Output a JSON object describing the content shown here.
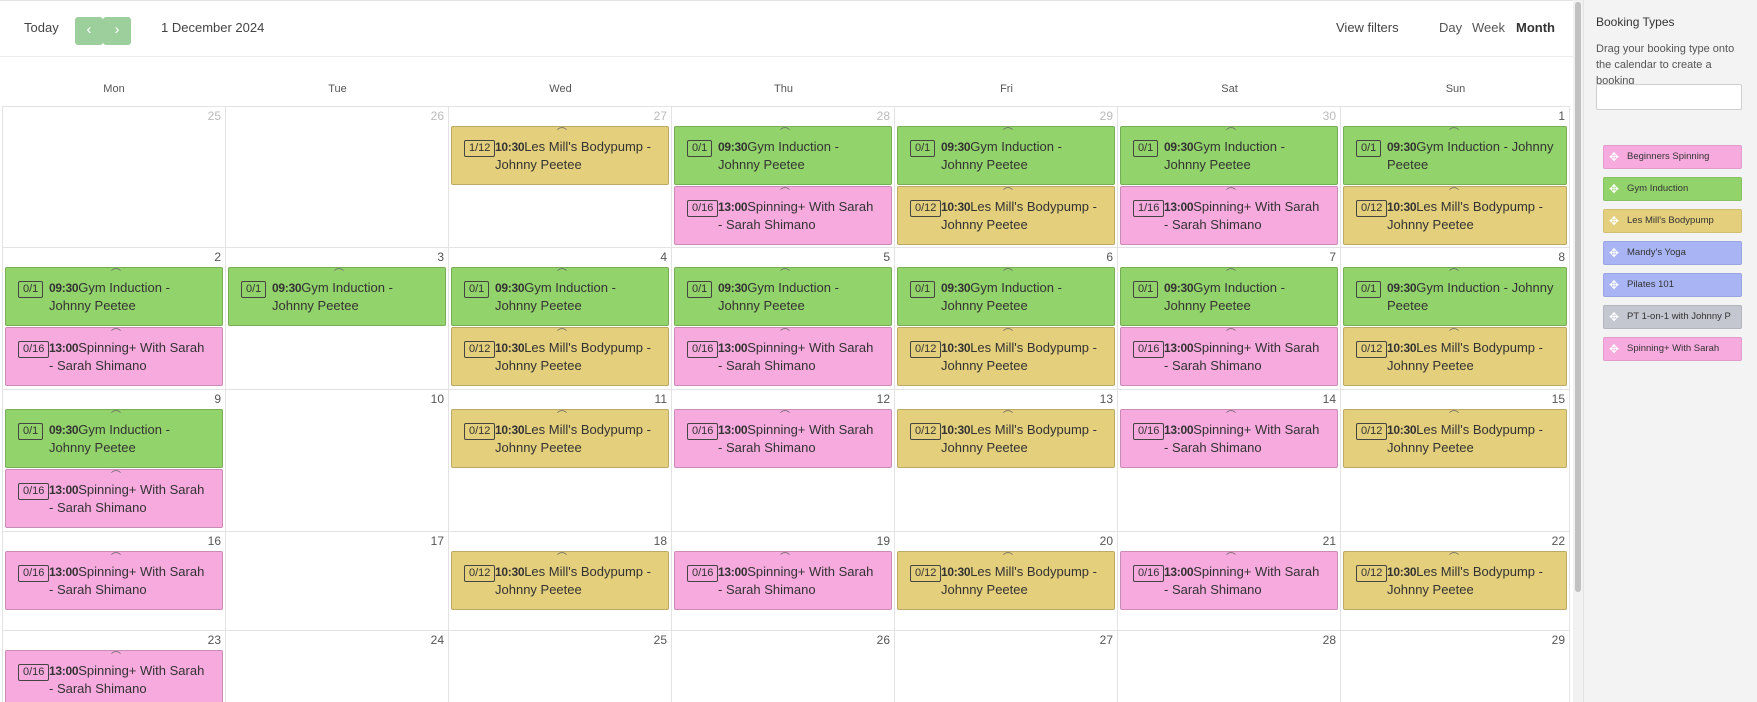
{
  "colors": {
    "green": "#93d36b",
    "pink": "#f7aade",
    "yellow": "#e4cf7c",
    "blue": "#a9b4f5",
    "grey": "#c4c6d0",
    "nav_button": "#9ccf9c"
  },
  "toolbar": {
    "today_label": "Today",
    "prev_icon": "chevron-left-icon",
    "prev_glyph": "‹",
    "next_icon": "chevron-right-icon",
    "next_glyph": "›",
    "current_date": "1 December 2024",
    "view_filters_label": "View filters",
    "views": [
      "Day",
      "Week",
      "Month"
    ],
    "active_view": "Month"
  },
  "calendar": {
    "weekdays": [
      "Mon",
      "Tue",
      "Wed",
      "Thu",
      "Fri",
      "Sat",
      "Sun"
    ],
    "weeks": [
      [
        {
          "day": "25",
          "muted": true,
          "events": []
        },
        {
          "day": "26",
          "muted": true,
          "events": []
        },
        {
          "day": "27",
          "muted": true,
          "events": [
            {
              "type": "bodypump",
              "capacity": "1/12",
              "time": "10:30",
              "title": "Les Mill's Bodypump - Johnny Peetee"
            }
          ]
        },
        {
          "day": "28",
          "muted": true,
          "events": [
            {
              "type": "induction",
              "capacity": "0/1",
              "time": "09:30",
              "title": "Gym Induction - Johnny Peetee"
            },
            {
              "type": "spinning",
              "capacity": "0/16",
              "time": "13:00",
              "title": "Spinning+ With Sarah - Sarah Shimano"
            }
          ]
        },
        {
          "day": "29",
          "muted": true,
          "events": [
            {
              "type": "induction",
              "capacity": "0/1",
              "time": "09:30",
              "title": "Gym Induction - Johnny Peetee"
            },
            {
              "type": "bodypump",
              "capacity": "0/12",
              "time": "10:30",
              "title": "Les Mill's Bodypump - Johnny Peetee"
            }
          ]
        },
        {
          "day": "30",
          "muted": true,
          "events": [
            {
              "type": "induction",
              "capacity": "0/1",
              "time": "09:30",
              "title": "Gym Induction - Johnny Peetee"
            },
            {
              "type": "spinning",
              "capacity": "1/16",
              "time": "13:00",
              "title": "Spinning+ With Sarah - Sarah Shimano"
            }
          ]
        },
        {
          "day": "1",
          "muted": false,
          "events": [
            {
              "type": "induction",
              "capacity": "0/1",
              "time": "09:30",
              "title": "Gym Induction - Johnny Peetee"
            },
            {
              "type": "bodypump",
              "capacity": "0/12",
              "time": "10:30",
              "title": "Les Mill's Bodypump - Johnny Peetee"
            }
          ]
        }
      ],
      [
        {
          "day": "2",
          "muted": false,
          "events": [
            {
              "type": "induction",
              "capacity": "0/1",
              "time": "09:30",
              "title": "Gym Induction - Johnny Peetee"
            },
            {
              "type": "spinning",
              "capacity": "0/16",
              "time": "13:00",
              "title": "Spinning+ With Sarah - Sarah Shimano"
            }
          ]
        },
        {
          "day": "3",
          "muted": false,
          "events": [
            {
              "type": "induction",
              "capacity": "0/1",
              "time": "09:30",
              "title": "Gym Induction - Johnny Peetee"
            }
          ]
        },
        {
          "day": "4",
          "muted": false,
          "events": [
            {
              "type": "induction",
              "capacity": "0/1",
              "time": "09:30",
              "title": "Gym Induction - Johnny Peetee"
            },
            {
              "type": "bodypump",
              "capacity": "0/12",
              "time": "10:30",
              "title": "Les Mill's Bodypump - Johnny Peetee"
            }
          ]
        },
        {
          "day": "5",
          "muted": false,
          "events": [
            {
              "type": "induction",
              "capacity": "0/1",
              "time": "09:30",
              "title": "Gym Induction - Johnny Peetee"
            },
            {
              "type": "spinning",
              "capacity": "0/16",
              "time": "13:00",
              "title": "Spinning+ With Sarah - Sarah Shimano"
            }
          ]
        },
        {
          "day": "6",
          "muted": false,
          "events": [
            {
              "type": "induction",
              "capacity": "0/1",
              "time": "09:30",
              "title": "Gym Induction - Johnny Peetee"
            },
            {
              "type": "bodypump",
              "capacity": "0/12",
              "time": "10:30",
              "title": "Les Mill's Bodypump - Johnny Peetee"
            }
          ]
        },
        {
          "day": "7",
          "muted": false,
          "events": [
            {
              "type": "induction",
              "capacity": "0/1",
              "time": "09:30",
              "title": "Gym Induction - Johnny Peetee"
            },
            {
              "type": "spinning",
              "capacity": "0/16",
              "time": "13:00",
              "title": "Spinning+ With Sarah - Sarah Shimano"
            }
          ]
        },
        {
          "day": "8",
          "muted": false,
          "events": [
            {
              "type": "induction",
              "capacity": "0/1",
              "time": "09:30",
              "title": "Gym Induction - Johnny Peetee"
            },
            {
              "type": "bodypump",
              "capacity": "0/12",
              "time": "10:30",
              "title": "Les Mill's Bodypump - Johnny Peetee"
            }
          ]
        }
      ],
      [
        {
          "day": "9",
          "muted": false,
          "events": [
            {
              "type": "induction",
              "capacity": "0/1",
              "time": "09:30",
              "title": "Gym Induction - Johnny Peetee"
            },
            {
              "type": "spinning",
              "capacity": "0/16",
              "time": "13:00",
              "title": "Spinning+ With Sarah - Sarah Shimano"
            }
          ]
        },
        {
          "day": "10",
          "muted": false,
          "events": []
        },
        {
          "day": "11",
          "muted": false,
          "events": [
            {
              "type": "bodypump",
              "capacity": "0/12",
              "time": "10:30",
              "title": "Les Mill's Bodypump - Johnny Peetee"
            }
          ]
        },
        {
          "day": "12",
          "muted": false,
          "events": [
            {
              "type": "spinning",
              "capacity": "0/16",
              "time": "13:00",
              "title": "Spinning+ With Sarah - Sarah Shimano"
            }
          ]
        },
        {
          "day": "13",
          "muted": false,
          "events": [
            {
              "type": "bodypump",
              "capacity": "0/12",
              "time": "10:30",
              "title": "Les Mill's Bodypump - Johnny Peetee"
            }
          ]
        },
        {
          "day": "14",
          "muted": false,
          "events": [
            {
              "type": "spinning",
              "capacity": "0/16",
              "time": "13:00",
              "title": "Spinning+ With Sarah - Sarah Shimano"
            }
          ]
        },
        {
          "day": "15",
          "muted": false,
          "events": [
            {
              "type": "bodypump",
              "capacity": "0/12",
              "time": "10:30",
              "title": "Les Mill's Bodypump - Johnny Peetee"
            }
          ]
        }
      ],
      [
        {
          "day": "16",
          "muted": false,
          "events": [
            {
              "type": "spinning",
              "capacity": "0/16",
              "time": "13:00",
              "title": "Spinning+ With Sarah - Sarah Shimano"
            }
          ]
        },
        {
          "day": "17",
          "muted": false,
          "events": []
        },
        {
          "day": "18",
          "muted": false,
          "events": [
            {
              "type": "bodypump",
              "capacity": "0/12",
              "time": "10:30",
              "title": "Les Mill's Bodypump - Johnny Peetee"
            }
          ]
        },
        {
          "day": "19",
          "muted": false,
          "events": [
            {
              "type": "spinning",
              "capacity": "0/16",
              "time": "13:00",
              "title": "Spinning+ With Sarah - Sarah Shimano"
            }
          ]
        },
        {
          "day": "20",
          "muted": false,
          "events": [
            {
              "type": "bodypump",
              "capacity": "0/12",
              "time": "10:30",
              "title": "Les Mill's Bodypump - Johnny Peetee"
            }
          ]
        },
        {
          "day": "21",
          "muted": false,
          "events": [
            {
              "type": "spinning",
              "capacity": "0/16",
              "time": "13:00",
              "title": "Spinning+ With Sarah - Sarah Shimano"
            }
          ]
        },
        {
          "day": "22",
          "muted": false,
          "events": [
            {
              "type": "bodypump",
              "capacity": "0/12",
              "time": "10:30",
              "title": "Les Mill's Bodypump - Johnny Peetee"
            }
          ]
        }
      ],
      [
        {
          "day": "23",
          "muted": false,
          "events": [
            {
              "type": "spinning",
              "capacity": "0/16",
              "time": "13:00",
              "title": "Spinning+ With Sarah - Sarah Shimano"
            }
          ]
        },
        {
          "day": "24",
          "muted": false,
          "events": []
        },
        {
          "day": "25",
          "muted": false,
          "events": []
        },
        {
          "day": "26",
          "muted": false,
          "events": []
        },
        {
          "day": "27",
          "muted": false,
          "events": []
        },
        {
          "day": "28",
          "muted": false,
          "events": []
        },
        {
          "day": "29",
          "muted": false,
          "events": []
        }
      ]
    ]
  },
  "sidebar": {
    "title": "Booking Types",
    "description": "Drag your booking type onto the calendar to create a booking",
    "search_value": "",
    "search_placeholder": "",
    "handle_icon": "move-icon",
    "booking_types": [
      {
        "label": "Beginners Spinning",
        "color": "pink"
      },
      {
        "label": "Gym Induction",
        "color": "green"
      },
      {
        "label": "Les Mill's Bodypump",
        "color": "yellow"
      },
      {
        "label": "Mandy's Yoga",
        "color": "blue"
      },
      {
        "label": "Pilates 101",
        "color": "blue"
      },
      {
        "label": "PT 1-on-1 with Johnny P",
        "color": "grey"
      },
      {
        "label": "Spinning+ With Sarah",
        "color": "pink"
      }
    ]
  }
}
